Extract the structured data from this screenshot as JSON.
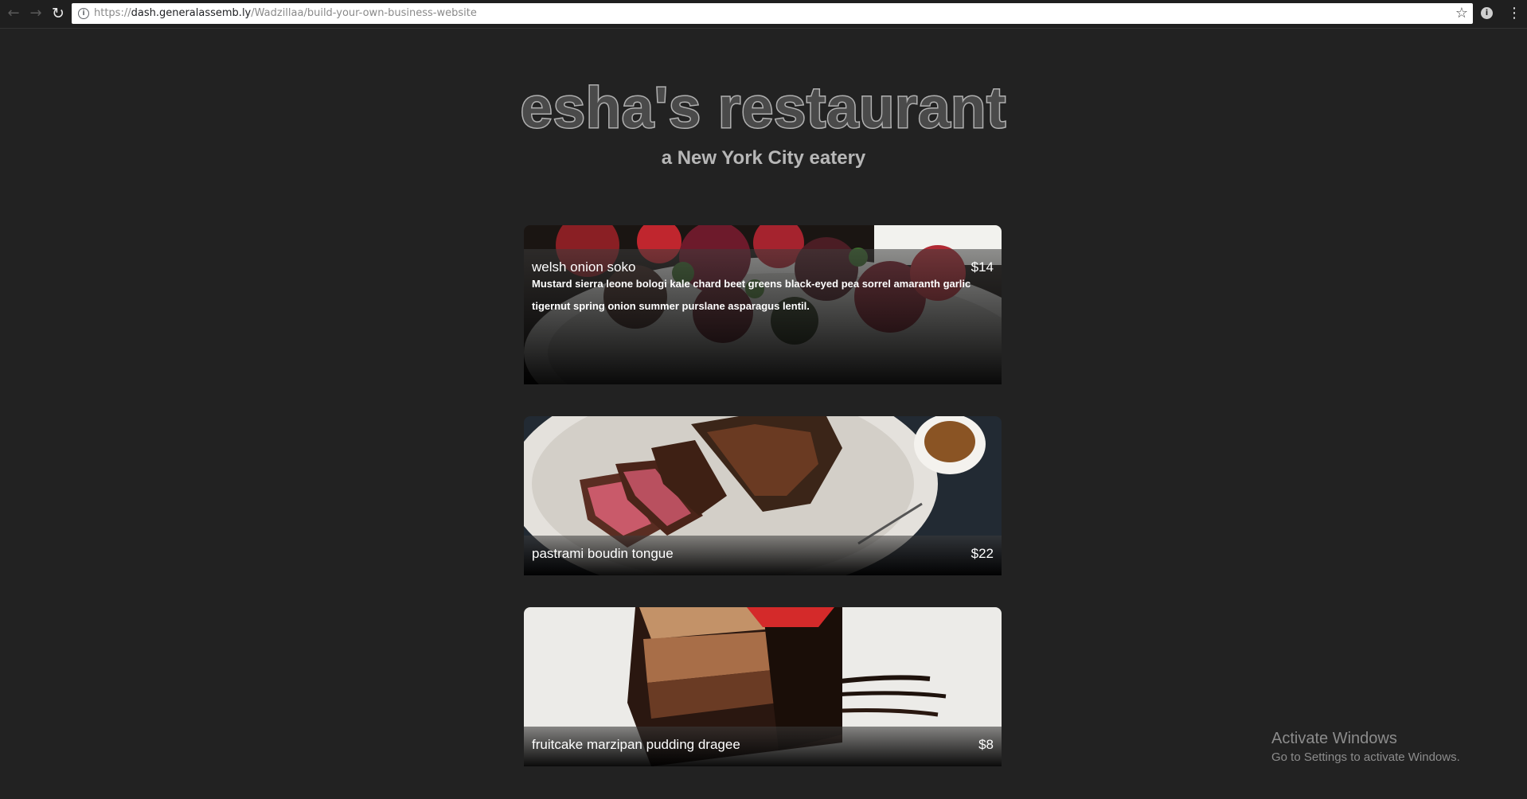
{
  "browser": {
    "url_scheme": "https://",
    "url_host": "dash.generalassemb.ly",
    "url_path": "/Wadzillaa/build-your-own-business-website"
  },
  "header": {
    "title": "esha's restaurant",
    "tagline": "a New York City eatery"
  },
  "menu": [
    {
      "name": "welsh onion soko",
      "price": "$14",
      "description": "Mustard sierra leone bologi kale chard beet greens black-eyed pea sorrel amaranth garlic tigernut spring onion summer purslane asparagus lentil."
    },
    {
      "name": "pastrami boudin tongue",
      "price": "$22"
    },
    {
      "name": "fruitcake marzipan pudding dragee",
      "price": "$8"
    }
  ],
  "watermark": {
    "title": "Activate Windows",
    "subtitle": "Go to Settings to activate Windows."
  },
  "colors": {
    "page_background": "#222222",
    "title_outline": "#b0b0b0",
    "tagline": "#b7b7b7"
  }
}
